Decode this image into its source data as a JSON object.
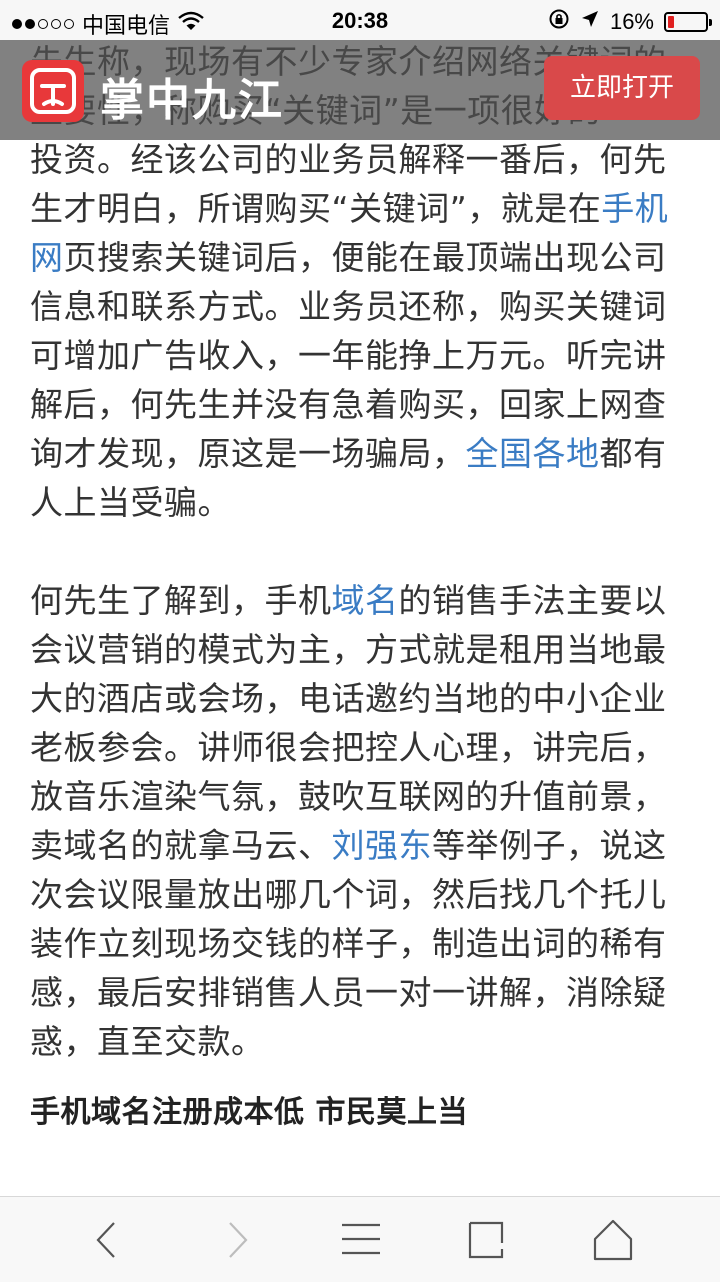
{
  "status_bar": {
    "carrier": "中国电信",
    "time": "20:38",
    "battery_percent_text": "16%",
    "battery_level": 0.16,
    "signal_bars_filled": 2,
    "signal_bars_total": 5,
    "icons": [
      "wifi-icon",
      "orientation-lock-icon",
      "location-arrow-icon",
      "battery-icon"
    ]
  },
  "banner": {
    "brand": "掌中九江",
    "open_button": "立即打开",
    "accent_color": "#e8383a"
  },
  "article": {
    "p1_lines": [
      [
        "先生称，现场有不少专家介绍网络关键词的"
      ],
      [
        "重要性，称购买“关键词”是一项很好的"
      ],
      [
        "投资。经该公司的业务员解释一番后，何先"
      ],
      [
        "生才明白，所谓购买“关键词”，就是在",
        {
          "link": "手机"
        }
      ],
      [
        {
          "link": "网"
        },
        "页搜索关键词后，便能在最顶端出现公司"
      ],
      [
        "信息和联系方式。业务员还称，购买关键词"
      ],
      [
        "可增加广告收入，一年能挣上万元。听完讲"
      ],
      [
        "解后，何先生并没有急着购买，回家上网查"
      ],
      [
        "询才发现，原这是一场骗局，",
        {
          "link": "全国各地"
        },
        "都有"
      ],
      [
        "人上当受骗。"
      ]
    ],
    "p2_lines": [
      [
        "何先生了解到，手机",
        {
          "link": "域名"
        },
        "的销售手法主要以"
      ],
      [
        "会议营销的模式为主，方式就是租用当地最"
      ],
      [
        "大的酒店或会场，电话邀约当地的中小企业"
      ],
      [
        "老板参会。讲师很会把控人心理，讲完后，"
      ],
      [
        "放音乐渲染气氛，鼓吹互联网的升值前景，"
      ],
      [
        "卖域名的就拿马云、",
        {
          "link": "刘强东"
        },
        "等举例子，说这"
      ],
      [
        "次会议限量放出哪几个词，然后找几个托儿"
      ],
      [
        "装作立刻现场交钱的样子，制造出词的稀有"
      ],
      [
        "感，最后安排销售人员一对一讲解，消除疑"
      ],
      [
        "惑，直至交款。"
      ]
    ],
    "heading": "手机域名注册成本低 市民莫上当",
    "link_color": "#3a7cc4"
  },
  "toolbar": {
    "items": [
      "back-icon",
      "forward-icon",
      "menu-icon",
      "tabs-icon",
      "home-icon"
    ]
  }
}
